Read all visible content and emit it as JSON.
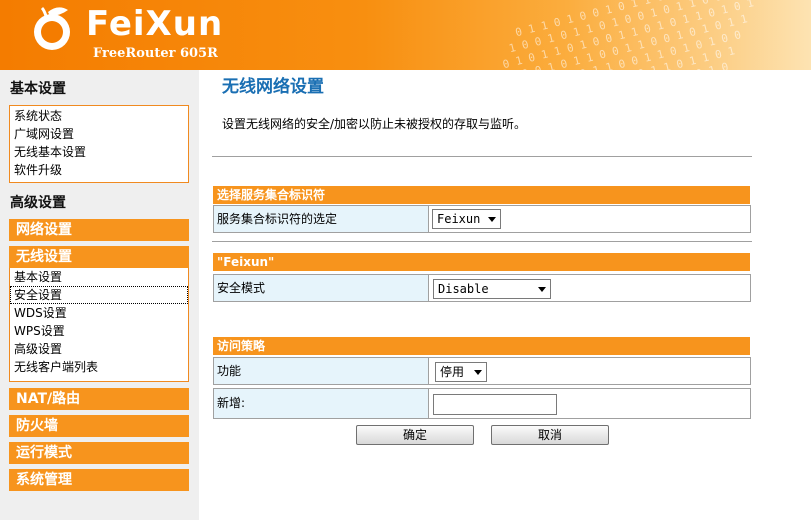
{
  "header": {
    "brand": "FeiXun",
    "model": "FreeRouter 605R"
  },
  "sidebar": {
    "basic_title": "基本设置",
    "basic_items": [
      "系统状态",
      "广域网设置",
      "无线基本设置",
      "软件升级"
    ],
    "advanced_title": "高级设置",
    "network_label": "网络设置",
    "wireless_label": "无线设置",
    "wireless_items": [
      "基本设置",
      "安全设置",
      "WDS设置",
      "WPS设置",
      "高级设置",
      "无线客户端列表"
    ],
    "nat_label": "NAT/路由",
    "firewall_label": "防火墙",
    "mode_label": "运行模式",
    "system_label": "系统管理"
  },
  "main": {
    "title": "无线网络设置",
    "description": "设置无线网络的安全/加密以防止未被授权的存取与监听。",
    "ssid_section": "选择服务集合标识符",
    "ssid_label": "服务集合标识符的选定",
    "ssid_value": "Feixun",
    "security_section": "\"Feixun\"",
    "security_label": "安全模式",
    "security_value": "Disable",
    "access_section": "访问策略",
    "function_label": "功能",
    "function_value": "停用",
    "new_label": "新增:",
    "new_value": "",
    "ok_button": "确定",
    "cancel_button": "取消"
  },
  "colors": {
    "accent": "#f7941d",
    "title_blue": "#1a6fb3",
    "label_bg": "#e6f4fb"
  }
}
